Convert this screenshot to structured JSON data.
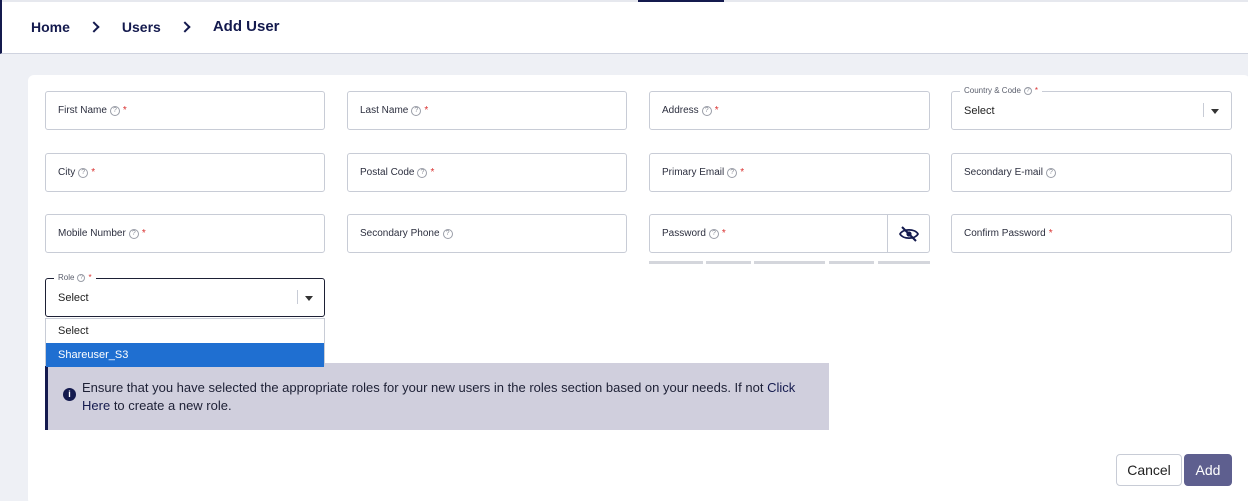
{
  "breadcrumb": {
    "home": "Home",
    "users": "Users",
    "current": "Add User"
  },
  "fields": {
    "first_name": "First Name",
    "last_name": "Last Name",
    "address": "Address",
    "country_code": {
      "label": "Country & Code",
      "value": "Select"
    },
    "city": "City",
    "postal_code": "Postal Code",
    "primary_email": "Primary Email",
    "secondary_email": "Secondary E-mail",
    "mobile_number": "Mobile Number",
    "secondary_phone": "Secondary Phone",
    "password": "Password",
    "confirm_password": "Confirm Password",
    "role": {
      "label": "Role",
      "value": "Select"
    }
  },
  "required_mark": "*",
  "help_mark": "?",
  "role_options": [
    "Select",
    "Shareuser_S3"
  ],
  "info": {
    "icon": "i",
    "text": "Ensure that you have selected the appropriate roles for your new users in the roles section based on your needs. If not",
    "link": "Click Here",
    "suffix": "to create a new role."
  },
  "actions": {
    "cancel": "Cancel",
    "add": "Add"
  },
  "colors": {
    "primary": "#141a4e",
    "selected_option": "#1f6fd1",
    "add_button": "#5e5f8f",
    "info_bg": "#d0cfdd",
    "required": "#d9302f"
  }
}
